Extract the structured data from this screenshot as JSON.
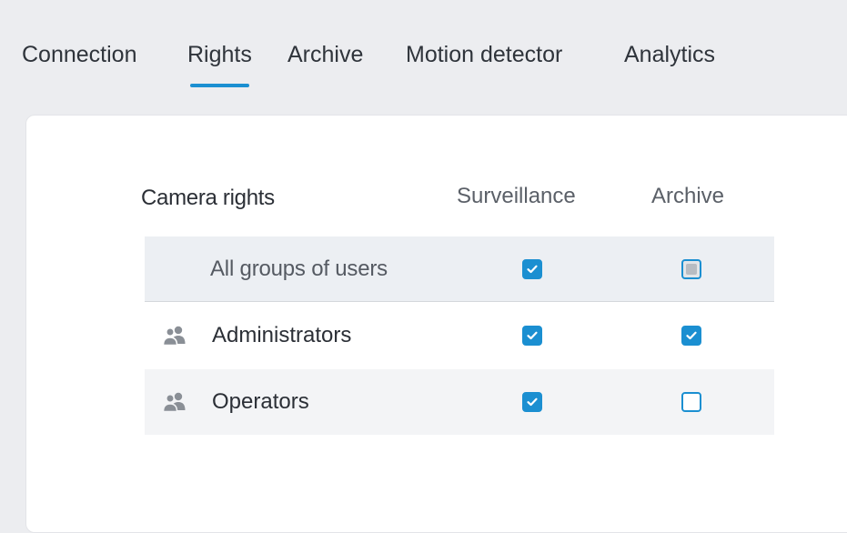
{
  "tabs": [
    {
      "label": "Connection",
      "active": false
    },
    {
      "label": "Rights",
      "active": true
    },
    {
      "label": "Archive",
      "active": false
    },
    {
      "label": "Motion detector",
      "active": false
    },
    {
      "label": "Analytics",
      "active": false
    }
  ],
  "table": {
    "title": "Camera rights",
    "columns": [
      "Surveillance",
      "Archive"
    ],
    "rows": [
      {
        "label": "All groups of users",
        "icon": "",
        "surveillance": "checked",
        "archive": "partial"
      },
      {
        "label": "Administrators",
        "icon": "user-group-icon",
        "surveillance": "checked",
        "archive": "checked"
      },
      {
        "label": "Operators",
        "icon": "user-group-icon",
        "surveillance": "checked",
        "archive": "unchecked"
      }
    ]
  },
  "colors": {
    "accent": "#1b8fd1",
    "background": "#ecedf0",
    "panel": "#ffffff"
  }
}
